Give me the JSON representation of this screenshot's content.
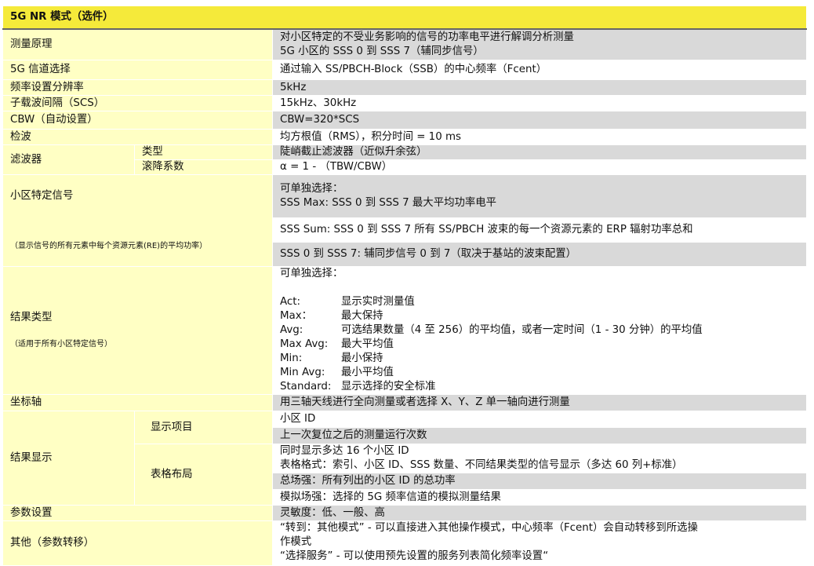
{
  "title": "5G NR 模式（选件）",
  "rows": {
    "principle": {
      "label": "测量原理",
      "value": "对小区特定的不受业务影响的信号的功率电平进行解调分析测量\n5G 小区的 SSS 0 到 SSS 7（辅同步信号）"
    },
    "channel": {
      "label": "5G 信道选择",
      "value": "通过输入 SS/PBCH-Block（SSB）的中心频率（Fcent）"
    },
    "resolution": {
      "label": "频率设置分辨率",
      "value": "5kHz"
    },
    "scs": {
      "label": "子载波间隔（SCS）",
      "value": "15kHz、30kHz"
    },
    "cbw": {
      "label": "CBW（自动设置）",
      "value": "CBW=320*SCS"
    },
    "detection": {
      "label": "检波",
      "value": "均方根值（RMS），积分时间 = 10 ms"
    },
    "filter": {
      "label": "滤波器",
      "type_label": "类型",
      "type_value": "陡峭截止滤波器（近似升余弦）",
      "rolloff_label": "滚降系数",
      "rolloff_value": "α = 1 - （TBW/CBW）"
    },
    "cell_signal": {
      "label": "小区特定信号",
      "note": "（显示信号的所有元素中每个资源元素(RE)的平均功率）",
      "values": [
        "可单独选择：\nSSS  Max: SSS 0 到 SSS 7 最大平均功率电平",
        "SSS Sum: SSS 0 到 SSS 7 所有 SS/PBCH 波束的每一个资源元素的 ERP 辐射功率总和",
        "SSS 0 到 SSS 7:  辅同步信号 0 到 7（取决于基站的波束配置）"
      ]
    },
    "result_type": {
      "label": "结果类型",
      "note": "（适用于所有小区特定信号）",
      "intro": "可单独选择：",
      "items": [
        {
          "key": "Act:",
          "desc": "显示实时测量值"
        },
        {
          "key": "Max：",
          "desc": "最大保持"
        },
        {
          "key": "Avg:",
          "desc": "可选结果数量（4 至 256）的平均值，或者一定时间（1 - 30 分钟）的平均值"
        },
        {
          "key": "Max Avg:",
          "desc": "最大平均值"
        },
        {
          "key": "Min:",
          "desc": "最小保持"
        },
        {
          "key": "Min Avg:",
          "desc": "最小平均值"
        },
        {
          "key": "Standard:",
          "desc": "显示选择的安全标准"
        }
      ]
    },
    "axis": {
      "label": "坐标轴",
      "value": "用三轴天线进行全向测量或者选择 X、Y、Z 单一轴向进行测量"
    },
    "result_display": {
      "label": "结果显示",
      "items_label": "显示项目",
      "items_values": [
        "小区 ID",
        "上一次复位之后的测量运行次数"
      ],
      "layout_label": "表格布局",
      "layout_values": [
        "同时显示多达 16 个小区 ID\n表格格式：索引、小区 ID、SSS 数量、不同结果类型的信号显示（多达 60 列+标准）",
        "总场强：所有列出的小区 ID 的总功率",
        "模拟场强：选择的 5G 频率信道的模拟测量结果"
      ]
    },
    "params": {
      "label": "参数设置",
      "value": "灵敏度：低、一般、高"
    },
    "other": {
      "label": "其他（参数转移）",
      "value": "“转到：其他模式” - 可以直接进入其他操作模式，中心频率（Fcent）会自动转移到所选操\n作模式\n“选择服务” - 可以使用预先设置的服务列表简化频率设置“"
    }
  },
  "colors": {
    "header": "#f5ea3a",
    "label_bg": "#ffffc4",
    "value_gray": "#d9d9d9",
    "value_white": "#ffffff"
  }
}
